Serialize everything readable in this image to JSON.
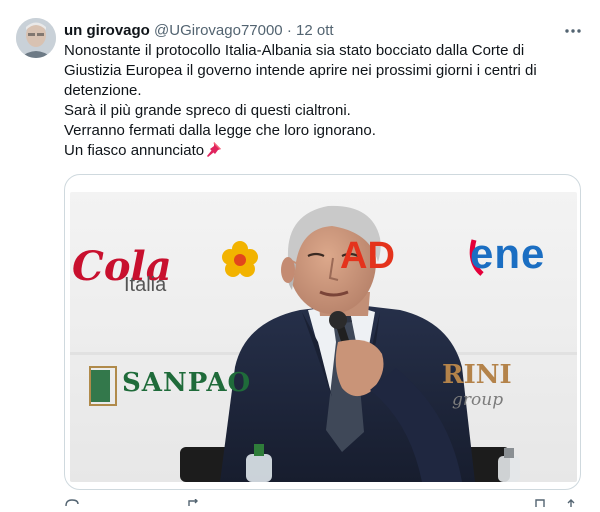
{
  "tweet": {
    "display_name": "un girovago",
    "handle": "@UGirovago77000",
    "separator": "·",
    "timestamp": "12 ott",
    "lines": [
      "Nonostante il protocollo Italia-Albania sia stato bocciato dalla Corte di Giustizia Europea il governo intende aprire nei prossimi giorni i centri di detenzione.",
      "Sarà il più grande spreco di questi cialtroni.",
      "Verranno fermati dalla legge che loro ignorano.",
      "Un fiasco annunciato"
    ],
    "emoji_icon": "pushpin-icon",
    "more_icon": "more-options-icon"
  },
  "photo": {
    "backdrop_logos": {
      "cola": "Cola",
      "italia": "Italia",
      "ad": "AD",
      "enel": "ene",
      "sanpaolo": "SANPAO",
      "rini": "RINI",
      "group": "group"
    }
  },
  "colors": {
    "text": "#0f1419",
    "muted": "#536471",
    "border": "#cfd9de",
    "coca_red": "#c8102e",
    "sanpaolo_green": "#1f6b3a",
    "enel_blue": "#1b6ec2",
    "enel_red": "#e4003a"
  }
}
